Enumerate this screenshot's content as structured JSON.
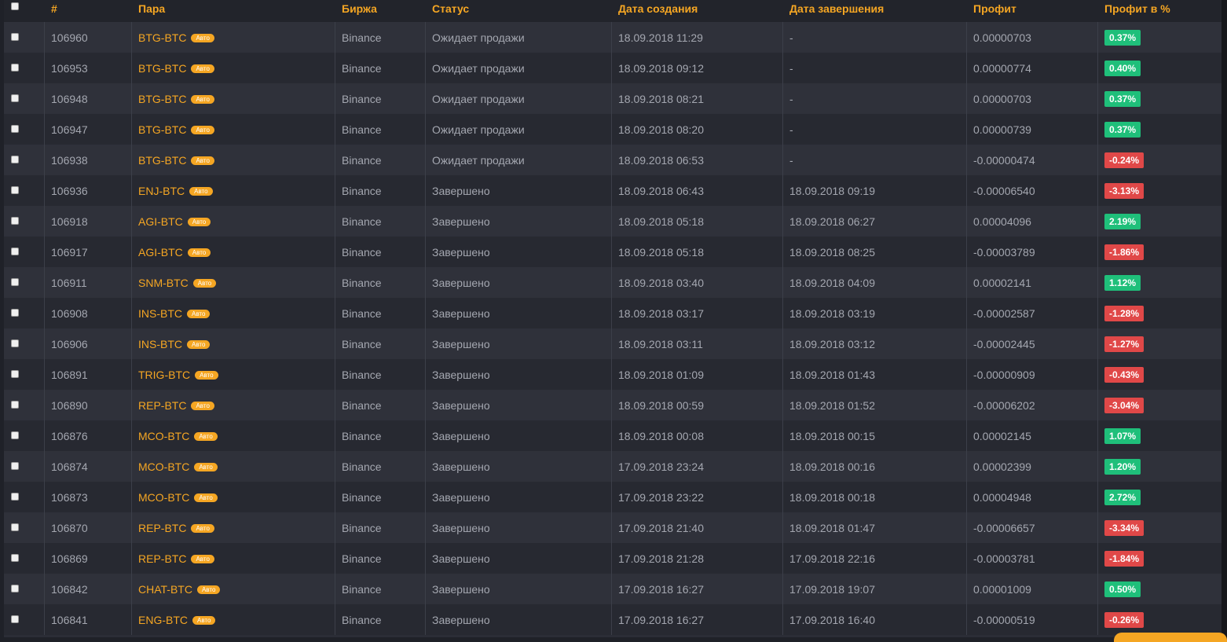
{
  "columns": {
    "id": "#",
    "pair": "Пара",
    "exchange": "Биржа",
    "status": "Статус",
    "created": "Дата создания",
    "finished": "Дата завершения",
    "profit": "Профит",
    "profit_pct": "Профит в %"
  },
  "auto_label": "Авто",
  "colors": {
    "accent": "#f5a623",
    "positive": "#1fbf7a",
    "negative": "#e04848"
  },
  "rows": [
    {
      "id": "106960",
      "pair": "BTG-BTC",
      "exchange": "Binance",
      "status": "Ожидает продажи",
      "created": "18.09.2018 11:29",
      "finished": "-",
      "profit": "0.00000703",
      "profit_pct": "0.37%",
      "positive": true
    },
    {
      "id": "106953",
      "pair": "BTG-BTC",
      "exchange": "Binance",
      "status": "Ожидает продажи",
      "created": "18.09.2018 09:12",
      "finished": "-",
      "profit": "0.00000774",
      "profit_pct": "0.40%",
      "positive": true
    },
    {
      "id": "106948",
      "pair": "BTG-BTC",
      "exchange": "Binance",
      "status": "Ожидает продажи",
      "created": "18.09.2018 08:21",
      "finished": "-",
      "profit": "0.00000703",
      "profit_pct": "0.37%",
      "positive": true
    },
    {
      "id": "106947",
      "pair": "BTG-BTC",
      "exchange": "Binance",
      "status": "Ожидает продажи",
      "created": "18.09.2018 08:20",
      "finished": "-",
      "profit": "0.00000739",
      "profit_pct": "0.37%",
      "positive": true
    },
    {
      "id": "106938",
      "pair": "BTG-BTC",
      "exchange": "Binance",
      "status": "Ожидает продажи",
      "created": "18.09.2018 06:53",
      "finished": "-",
      "profit": "-0.00000474",
      "profit_pct": "-0.24%",
      "positive": false
    },
    {
      "id": "106936",
      "pair": "ENJ-BTC",
      "exchange": "Binance",
      "status": "Завершено",
      "created": "18.09.2018 06:43",
      "finished": "18.09.2018 09:19",
      "profit": "-0.00006540",
      "profit_pct": "-3.13%",
      "positive": false
    },
    {
      "id": "106918",
      "pair": "AGI-BTC",
      "exchange": "Binance",
      "status": "Завершено",
      "created": "18.09.2018 05:18",
      "finished": "18.09.2018 06:27",
      "profit": "0.00004096",
      "profit_pct": "2.19%",
      "positive": true
    },
    {
      "id": "106917",
      "pair": "AGI-BTC",
      "exchange": "Binance",
      "status": "Завершено",
      "created": "18.09.2018 05:18",
      "finished": "18.09.2018 08:25",
      "profit": "-0.00003789",
      "profit_pct": "-1.86%",
      "positive": false
    },
    {
      "id": "106911",
      "pair": "SNM-BTC",
      "exchange": "Binance",
      "status": "Завершено",
      "created": "18.09.2018 03:40",
      "finished": "18.09.2018 04:09",
      "profit": "0.00002141",
      "profit_pct": "1.12%",
      "positive": true
    },
    {
      "id": "106908",
      "pair": "INS-BTC",
      "exchange": "Binance",
      "status": "Завершено",
      "created": "18.09.2018 03:17",
      "finished": "18.09.2018 03:19",
      "profit": "-0.00002587",
      "profit_pct": "-1.28%",
      "positive": false
    },
    {
      "id": "106906",
      "pair": "INS-BTC",
      "exchange": "Binance",
      "status": "Завершено",
      "created": "18.09.2018 03:11",
      "finished": "18.09.2018 03:12",
      "profit": "-0.00002445",
      "profit_pct": "-1.27%",
      "positive": false
    },
    {
      "id": "106891",
      "pair": "TRIG-BTC",
      "exchange": "Binance",
      "status": "Завершено",
      "created": "18.09.2018 01:09",
      "finished": "18.09.2018 01:43",
      "profit": "-0.00000909",
      "profit_pct": "-0.43%",
      "positive": false
    },
    {
      "id": "106890",
      "pair": "REP-BTC",
      "exchange": "Binance",
      "status": "Завершено",
      "created": "18.09.2018 00:59",
      "finished": "18.09.2018 01:52",
      "profit": "-0.00006202",
      "profit_pct": "-3.04%",
      "positive": false
    },
    {
      "id": "106876",
      "pair": "MCO-BTC",
      "exchange": "Binance",
      "status": "Завершено",
      "created": "18.09.2018 00:08",
      "finished": "18.09.2018 00:15",
      "profit": "0.00002145",
      "profit_pct": "1.07%",
      "positive": true
    },
    {
      "id": "106874",
      "pair": "MCO-BTC",
      "exchange": "Binance",
      "status": "Завершено",
      "created": "17.09.2018 23:24",
      "finished": "18.09.2018 00:16",
      "profit": "0.00002399",
      "profit_pct": "1.20%",
      "positive": true
    },
    {
      "id": "106873",
      "pair": "MCO-BTC",
      "exchange": "Binance",
      "status": "Завершено",
      "created": "17.09.2018 23:22",
      "finished": "18.09.2018 00:18",
      "profit": "0.00004948",
      "profit_pct": "2.72%",
      "positive": true
    },
    {
      "id": "106870",
      "pair": "REP-BTC",
      "exchange": "Binance",
      "status": "Завершено",
      "created": "17.09.2018 21:40",
      "finished": "18.09.2018 01:47",
      "profit": "-0.00006657",
      "profit_pct": "-3.34%",
      "positive": false
    },
    {
      "id": "106869",
      "pair": "REP-BTC",
      "exchange": "Binance",
      "status": "Завершено",
      "created": "17.09.2018 21:28",
      "finished": "17.09.2018 22:16",
      "profit": "-0.00003781",
      "profit_pct": "-1.84%",
      "positive": false
    },
    {
      "id": "106842",
      "pair": "CHAT-BTC",
      "exchange": "Binance",
      "status": "Завершено",
      "created": "17.09.2018 16:27",
      "finished": "17.09.2018 19:07",
      "profit": "0.00001009",
      "profit_pct": "0.50%",
      "positive": true
    },
    {
      "id": "106841",
      "pair": "ENG-BTC",
      "exchange": "Binance",
      "status": "Завершено",
      "created": "17.09.2018 16:27",
      "finished": "17.09.2018 16:40",
      "profit": "-0.00000519",
      "profit_pct": "-0.26%",
      "positive": false
    }
  ]
}
